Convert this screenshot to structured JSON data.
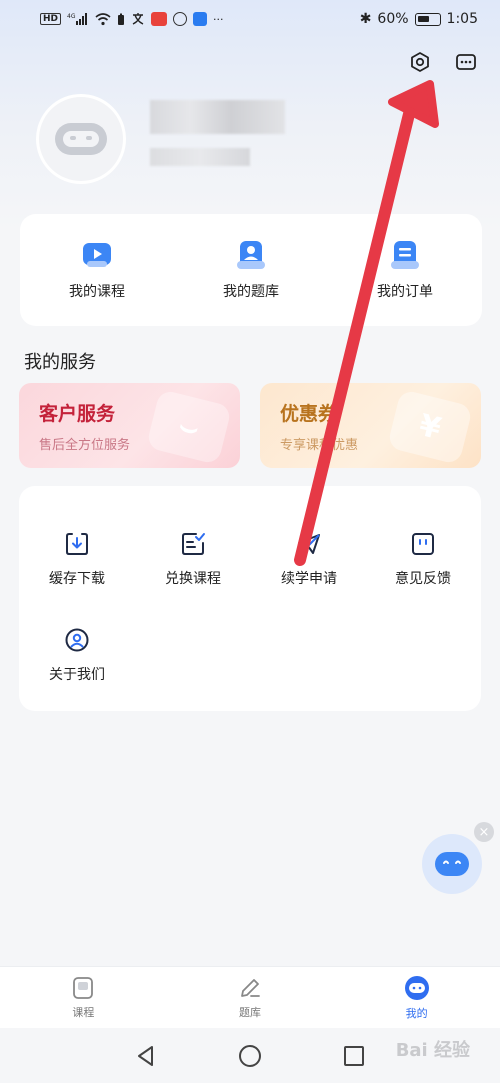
{
  "status_bar": {
    "left_icons": [
      "hd-badge",
      "signal-4g-icon",
      "wifi-icon",
      "battery-saver-icon",
      "translate-icon",
      "app-red-icon",
      "app-circle-icon",
      "app-blue-icon",
      "more-dots"
    ],
    "bluetooth": "✱",
    "battery_percent": "60%",
    "battery_level": 0.6,
    "time": "1:05"
  },
  "header": {
    "settings_icon": "settings-hex-icon",
    "more_icon": "more-icon"
  },
  "profile": {
    "avatar_icon": "robot-avatar-icon"
  },
  "quick_links": [
    {
      "label": "我的课程",
      "icon": "play-course-icon",
      "color": "#3c86f5"
    },
    {
      "label": "我的题库",
      "icon": "user-question-icon",
      "color": "#3c86f5"
    },
    {
      "label": "我的订单",
      "icon": "order-icon",
      "color": "#3c86f5"
    }
  ],
  "services": {
    "title": "我的服务",
    "promos": [
      {
        "title": "客户服务",
        "subtitle": "售后全方位服务",
        "deco": "⌣"
      },
      {
        "title": "优惠券",
        "subtitle": "专享课程优惠",
        "deco": "¥"
      }
    ],
    "items": [
      {
        "label": "缓存下载",
        "icon": "download-icon"
      },
      {
        "label": "兑换课程",
        "icon": "exchange-icon"
      },
      {
        "label": "续学申请",
        "icon": "send-icon"
      },
      {
        "label": "意见反馈",
        "icon": "feedback-icon"
      },
      {
        "label": "关于我们",
        "icon": "about-icon"
      }
    ]
  },
  "float": {
    "close": "×"
  },
  "tab_bar": [
    {
      "label": "课程",
      "icon": "course-tab-icon",
      "active": false
    },
    {
      "label": "题库",
      "icon": "pen-tab-icon",
      "active": false
    },
    {
      "label": "我的",
      "icon": "me-tab-icon",
      "active": true
    }
  ],
  "watermark": "Bai 经验",
  "colors": {
    "accent": "#2f6df0",
    "arrow": "#e63946"
  }
}
